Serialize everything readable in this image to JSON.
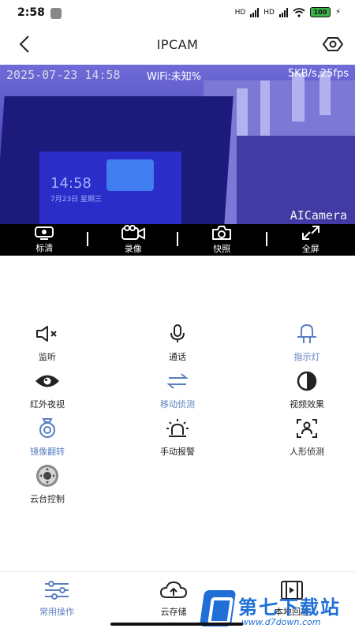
{
  "status_bar": {
    "time": "2:58",
    "network_1": "HD",
    "network_2": "HD",
    "battery": "100"
  },
  "header": {
    "title": "IPCAM",
    "back_icon": "chevron-left-icon",
    "settings_icon": "hexagon-eye-icon"
  },
  "video": {
    "timestamp": "2025-07-23 14:58",
    "wifi_status": "WiFi:未知%",
    "stream_rate": "5KB/s,25fps",
    "brand_overlay": "AICamera",
    "screen_clock": "14:58",
    "screen_date": "7月23日 星期三"
  },
  "toolbar": {
    "items": [
      {
        "label": "标清",
        "icon": "sd-quality-icon"
      },
      {
        "label": "录像",
        "icon": "video-record-icon"
      },
      {
        "label": "快照",
        "icon": "camera-icon"
      },
      {
        "label": "全屏",
        "icon": "fullscreen-icon"
      }
    ]
  },
  "controls": {
    "items": [
      {
        "label": "监听",
        "icon": "speaker-mute-icon",
        "active": false
      },
      {
        "label": "通话",
        "icon": "microphone-icon",
        "active": false
      },
      {
        "label": "指示灯",
        "icon": "indicator-light-icon",
        "active": true
      },
      {
        "label": "红外夜视",
        "icon": "eye-icon",
        "active": false
      },
      {
        "label": "移动侦测",
        "icon": "motion-arrows-icon",
        "active": true
      },
      {
        "label": "视频效果",
        "icon": "contrast-icon",
        "active": false
      },
      {
        "label": "镜像翻转",
        "icon": "mirror-flip-icon",
        "active": true
      },
      {
        "label": "手动报警",
        "icon": "alarm-siren-icon",
        "active": false
      },
      {
        "label": "人形侦测",
        "icon": "human-detect-icon",
        "active": false
      },
      {
        "label": "云台控制",
        "icon": "ptz-control-icon",
        "active": false
      }
    ]
  },
  "bottom_nav": {
    "items": [
      {
        "label": "常用操作",
        "icon": "sliders-icon",
        "active": true
      },
      {
        "label": "云存储",
        "icon": "cloud-icon",
        "active": false
      },
      {
        "label": "本地回放",
        "icon": "film-icon",
        "active": false
      }
    ]
  },
  "watermark": {
    "name": "第七下载站",
    "url": "www.d7down.com"
  },
  "colors": {
    "accent": "#5a7fc0",
    "toolbar_bg": "#000000",
    "video_tint": "#4d48b8"
  }
}
